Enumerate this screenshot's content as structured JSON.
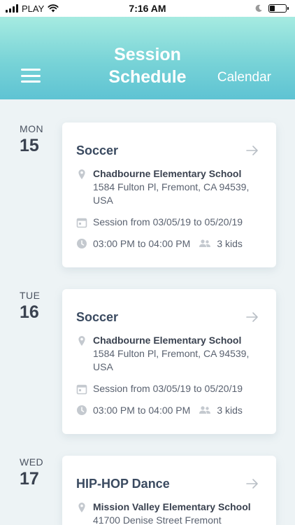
{
  "status_bar": {
    "carrier": "PLAY",
    "time": "7:16 AM"
  },
  "header": {
    "title": "Session Schedule",
    "action": "Calendar"
  },
  "days": [
    {
      "day_name": "MON",
      "day_num": "15",
      "card": {
        "title": "Soccer",
        "school": "Chadbourne Elementary School",
        "address": "1584 Fulton Pl, Fremont, CA 94539, USA",
        "session": "Session from 03/05/19 to 05/20/19",
        "time": "03:00 PM to 04:00 PM",
        "kids": "3 kids"
      }
    },
    {
      "day_name": "TUE",
      "day_num": "16",
      "card": {
        "title": "Soccer",
        "school": "Chadbourne Elementary School",
        "address": "1584 Fulton Pl, Fremont, CA 94539, USA",
        "session": "Session from 03/05/19 to 05/20/19",
        "time": "03:00 PM to 04:00 PM",
        "kids": "3 kids"
      }
    },
    {
      "day_name": "WED",
      "day_num": "17",
      "card": {
        "title": "HIP-HOP Dance",
        "school": "Mission Valley Elementary School",
        "address": "41700 Denise Street Fremont"
      }
    }
  ],
  "colors": {
    "header_top": "#a6ebe1",
    "header_bottom": "#5ec3d3",
    "background": "#edf3f5",
    "icon_gray": "#c4c9cf"
  }
}
